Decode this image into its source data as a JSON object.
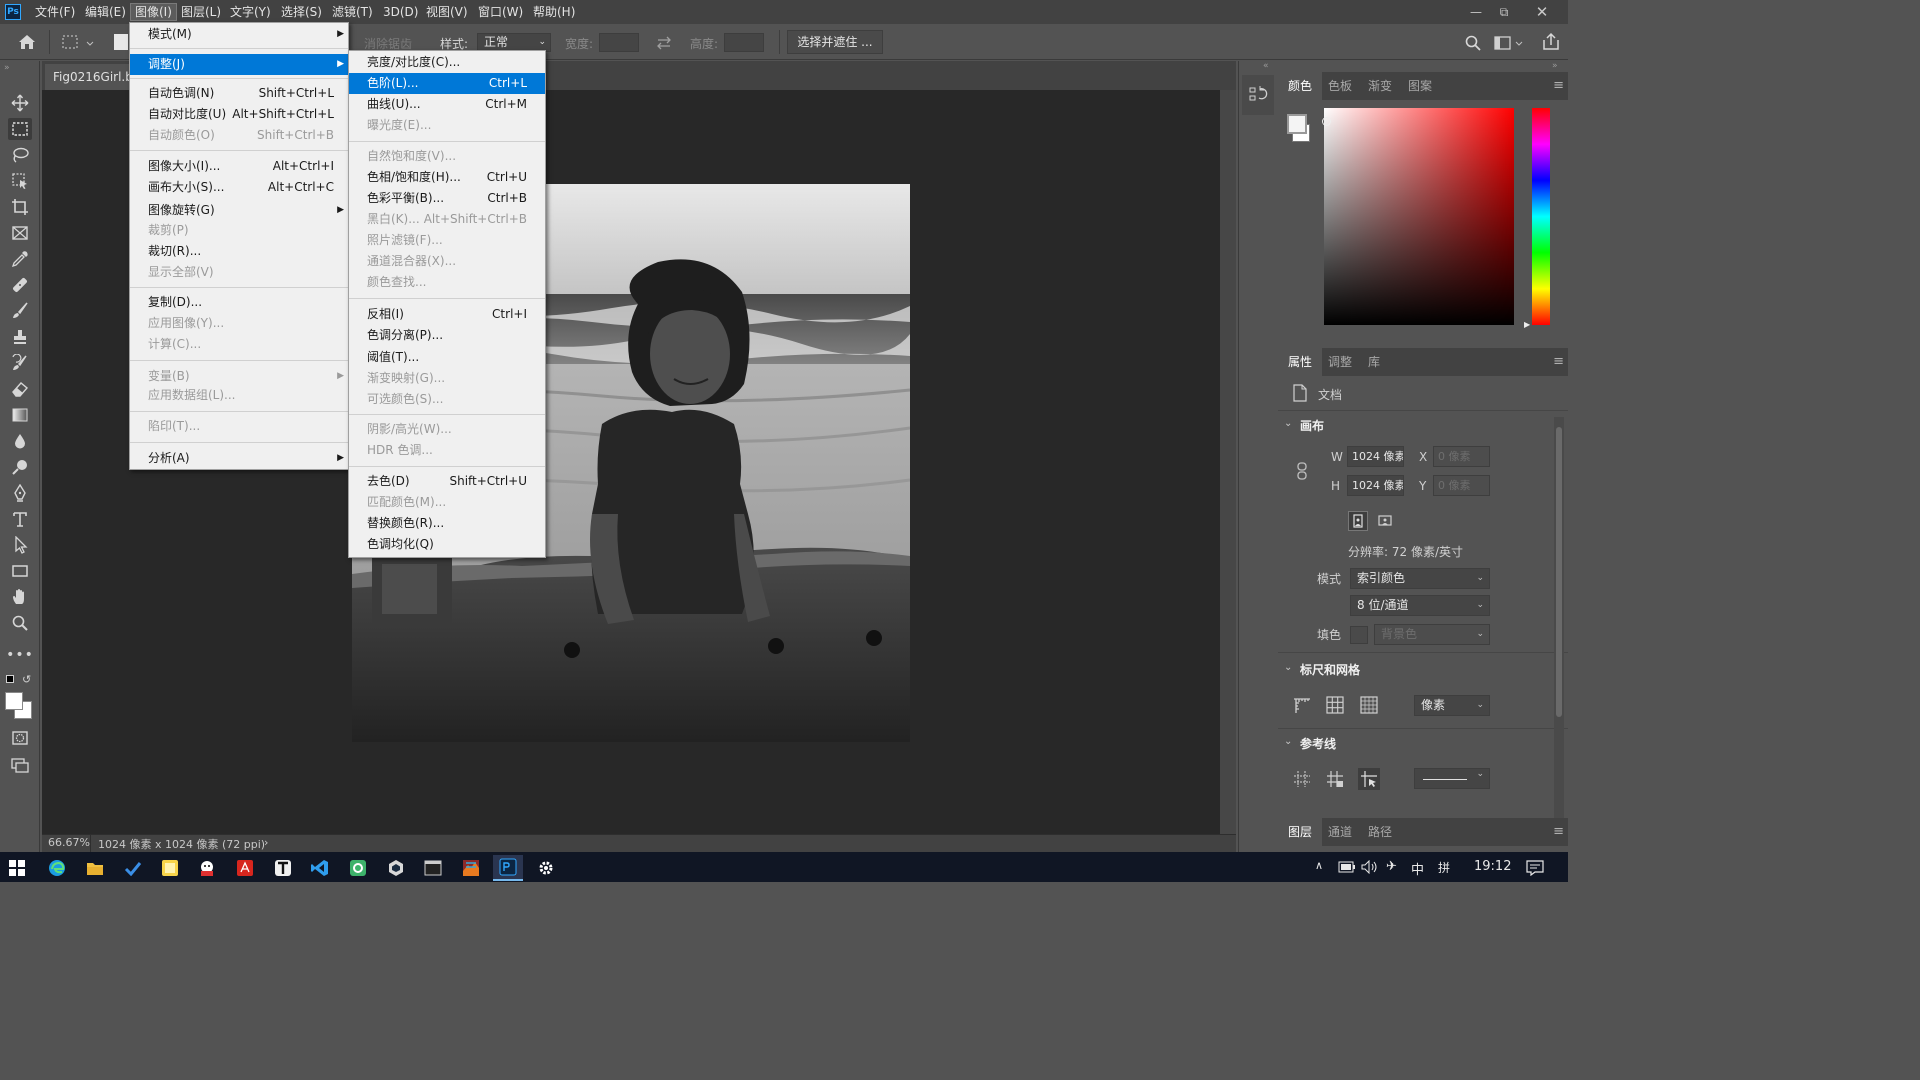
{
  "app": {
    "logo": "Ps",
    "accent": "#31a8ff"
  },
  "menubar": {
    "items": [
      "文件(F)",
      "编辑(E)",
      "图像(I)",
      "图层(L)",
      "文字(Y)",
      "选择(S)",
      "滤镜(T)",
      "3D(D)",
      "视图(V)",
      "窗口(W)",
      "帮助(H)"
    ],
    "open_item": "图像(I)"
  },
  "window_controls": {
    "minimize_icon": "minimize-icon",
    "restore_icon": "restore-icon",
    "close_icon": "close-icon"
  },
  "options": {
    "antialias": "消除锯齿",
    "style_label": "样式:",
    "style_value": "正常",
    "width_label": "宽度:",
    "height_label": "高度:",
    "select_mask": "选择并遮住 ..."
  },
  "document": {
    "tab_title": "Fig0216Girl.bmp",
    "zoom": "66.67%",
    "info": "1024 像素 x 1024 像素 (72 ppi)",
    "status_arrow": "›"
  },
  "image_menu": {
    "items": [
      {
        "label": "模式(M)",
        "shortcut": "",
        "disabled": false,
        "submenu": true
      },
      {
        "label": "调整(J)",
        "shortcut": "",
        "disabled": false,
        "submenu": true,
        "highlighted": true
      },
      {
        "label": "自动色调(N)",
        "shortcut": "Shift+Ctrl+L",
        "disabled": false
      },
      {
        "label": "自动对比度(U)",
        "shortcut": "Alt+Shift+Ctrl+L",
        "disabled": false
      },
      {
        "label": "自动颜色(O)",
        "shortcut": "Shift+Ctrl+B",
        "disabled": true
      },
      {
        "label": "图像大小(I)...",
        "shortcut": "Alt+Ctrl+I",
        "disabled": false
      },
      {
        "label": "画布大小(S)...",
        "shortcut": "Alt+Ctrl+C",
        "disabled": false
      },
      {
        "label": "图像旋转(G)",
        "shortcut": "",
        "disabled": false,
        "submenu": true
      },
      {
        "label": "裁剪(P)",
        "shortcut": "",
        "disabled": true
      },
      {
        "label": "裁切(R)...",
        "shortcut": "",
        "disabled": false
      },
      {
        "label": "显示全部(V)",
        "shortcut": "",
        "disabled": true
      },
      {
        "label": "复制(D)...",
        "shortcut": "",
        "disabled": false
      },
      {
        "label": "应用图像(Y)...",
        "shortcut": "",
        "disabled": true
      },
      {
        "label": "计算(C)...",
        "shortcut": "",
        "disabled": true
      },
      {
        "label": "变量(B)",
        "shortcut": "",
        "disabled": true,
        "submenu": true
      },
      {
        "label": "应用数据组(L)...",
        "shortcut": "",
        "disabled": true
      },
      {
        "label": "陷印(T)...",
        "shortcut": "",
        "disabled": true
      },
      {
        "label": "分析(A)",
        "shortcut": "",
        "disabled": false,
        "submenu": true
      }
    ]
  },
  "adjust_menu": {
    "items": [
      {
        "label": "亮度/对比度(C)...",
        "shortcut": "",
        "disabled": false
      },
      {
        "label": "色阶(L)...",
        "shortcut": "Ctrl+L",
        "disabled": false,
        "highlighted": true
      },
      {
        "label": "曲线(U)...",
        "shortcut": "Ctrl+M",
        "disabled": false
      },
      {
        "label": "曝光度(E)...",
        "shortcut": "",
        "disabled": true
      },
      {
        "label": "自然饱和度(V)...",
        "shortcut": "",
        "disabled": true
      },
      {
        "label": "色相/饱和度(H)...",
        "shortcut": "Ctrl+U",
        "disabled": false
      },
      {
        "label": "色彩平衡(B)...",
        "shortcut": "Ctrl+B",
        "disabled": false
      },
      {
        "label": "黑白(K)...",
        "shortcut": "Alt+Shift+Ctrl+B",
        "disabled": true
      },
      {
        "label": "照片滤镜(F)...",
        "shortcut": "",
        "disabled": true
      },
      {
        "label": "通道混合器(X)...",
        "shortcut": "",
        "disabled": true
      },
      {
        "label": "颜色查找...",
        "shortcut": "",
        "disabled": true
      },
      {
        "label": "反相(I)",
        "shortcut": "Ctrl+I",
        "disabled": false
      },
      {
        "label": "色调分离(P)...",
        "shortcut": "",
        "disabled": false
      },
      {
        "label": "阈值(T)...",
        "shortcut": "",
        "disabled": false
      },
      {
        "label": "渐变映射(G)...",
        "shortcut": "",
        "disabled": true
      },
      {
        "label": "可选颜色(S)...",
        "shortcut": "",
        "disabled": true
      },
      {
        "label": "阴影/高光(W)...",
        "shortcut": "",
        "disabled": true
      },
      {
        "label": "HDR 色调...",
        "shortcut": "",
        "disabled": true
      },
      {
        "label": "去色(D)",
        "shortcut": "Shift+Ctrl+U",
        "disabled": false
      },
      {
        "label": "匹配颜色(M)...",
        "shortcut": "",
        "disabled": true
      },
      {
        "label": "替换颜色(R)...",
        "shortcut": "",
        "disabled": false
      },
      {
        "label": "色调均化(Q)",
        "shortcut": "",
        "disabled": false
      }
    ]
  },
  "color_panel": {
    "tabs": [
      "颜色",
      "色板",
      "渐变",
      "图案"
    ],
    "active_tab": "颜色",
    "hue_color": "#ff0000"
  },
  "properties_panel": {
    "tabs": [
      "属性",
      "调整",
      "库"
    ],
    "active_tab": "属性",
    "doc_label": "文档",
    "canvas": {
      "title": "画布",
      "w_label": "W",
      "w_value": "1024 像素",
      "h_label": "H",
      "h_value": "1024 像素",
      "x_label": "X",
      "x_placeholder": "0 像素",
      "y_label": "Y",
      "y_placeholder": "0 像素",
      "resolution": "分辨率: 72 像素/英寸",
      "mode_label": "模式",
      "mode_value": "索引颜色",
      "depth_value": "8 位/通道",
      "fill_label": "填色",
      "fill_value": "背景色"
    },
    "rulers": {
      "title": "标尺和网格",
      "unit": "像素"
    },
    "guides": {
      "title": "参考线"
    }
  },
  "layers_panel": {
    "tabs": [
      "图层",
      "通道",
      "路径"
    ],
    "active_tab": "图层"
  },
  "taskbar": {
    "apps": [
      "windows-icon",
      "edge-icon",
      "explorer-icon",
      "todo-icon",
      "sticky-icon",
      "red-app-icon",
      "acrobat-icon",
      "typora-icon",
      "vscode-icon",
      "green-app-icon",
      "device-icon",
      "terminal-icon",
      "matlab-icon",
      "photoshop-icon",
      "settings-icon"
    ],
    "ime": "中",
    "ime2": "拼",
    "time": "19:12"
  }
}
